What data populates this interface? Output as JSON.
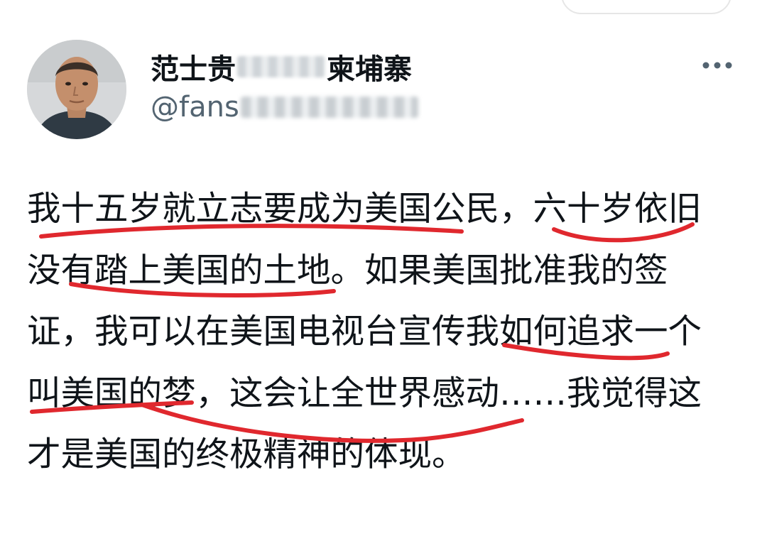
{
  "author": {
    "display_name_start": "范士贵",
    "display_name_end": "柬埔寨",
    "handle": "@fans"
  },
  "tweet": {
    "lines": [
      "我十五岁就立志要成为美国公民，六十岁依旧",
      "没有踏上美国的土地。如果美国批准我的签",
      "证，我可以在美国电视台宣传我如何追求一个",
      "叫美国的梦，这会让全世界感动……我觉得这",
      "才是美国的终极精神的体现。"
    ]
  },
  "icons": {
    "more": "more-horizontal-icon"
  },
  "colors": {
    "text": "#0f1419",
    "secondary_text": "#536471",
    "annotation_red": "#e0282e"
  }
}
